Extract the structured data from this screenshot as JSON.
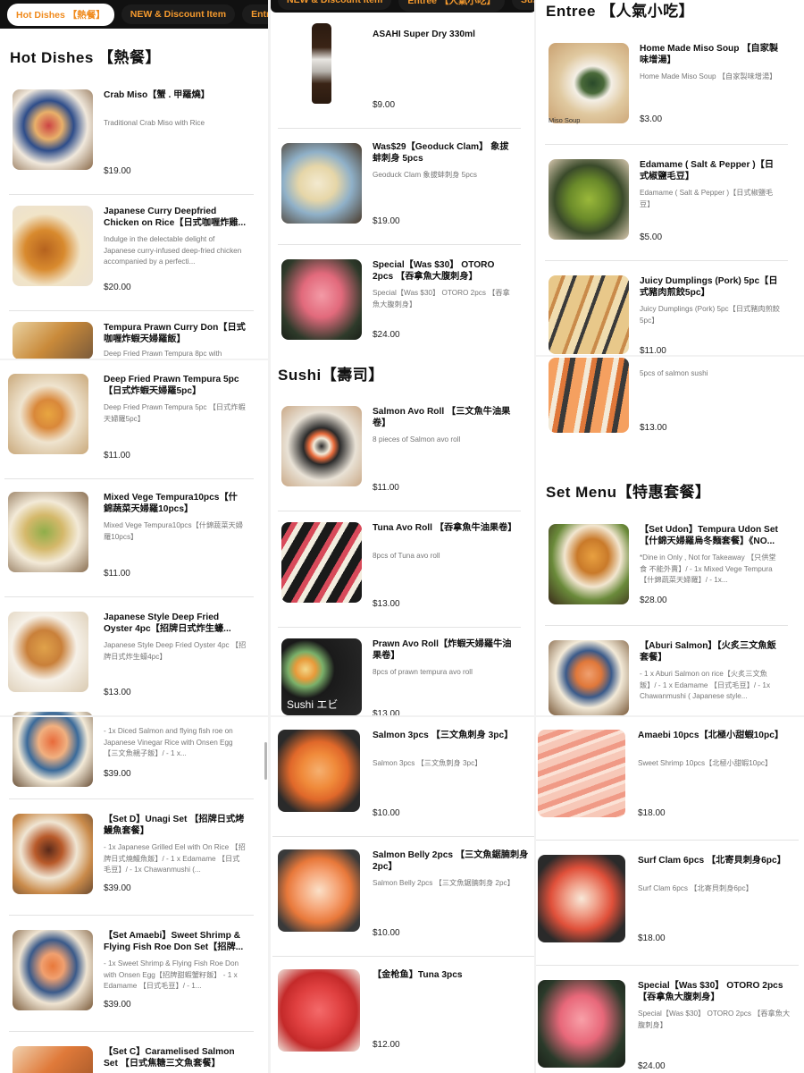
{
  "tabs_left": [
    {
      "label": "Hot Dishes 【熱餐】",
      "active": true
    },
    {
      "label": "NEW & Discount Item"
    },
    {
      "label": "Entree"
    }
  ],
  "tabs_mid": [
    {
      "label": "NEW & Discount Item"
    },
    {
      "label": "Entree 【人氣小吃】"
    },
    {
      "label": "Sushi"
    }
  ],
  "sections": {
    "hot": "Hot Dishes 【熱餐】",
    "sushi": "Sushi【壽司】",
    "entree": "Entree 【人氣小吃】",
    "set": "Set Menu【特惠套餐】"
  },
  "colors": {
    "accent": "#f08a1c",
    "tabbar": "#111111",
    "tab_active_bg": "#ffffff"
  },
  "cards": [
    {
      "name": "Crab Miso【蟹 . 甲羅燒】",
      "desc": "Traditional Crab Miso with Rice",
      "price": "$19.00",
      "img": "img-crab"
    },
    {
      "name": "Japanese Curry Deepfried Chicken on Rice【日式咖喱炸雞...",
      "desc": "Indulge in the delectable delight of Japanese curry-infused deep-fried chicken accompanied by a perfecti...",
      "price": "$20.00",
      "img": "img-curry"
    },
    {
      "name": "Tempura Prawn Curry Don【日式咖喱炸蝦天婦羅飯】",
      "desc": "Deep Fried Prawn Tempura 8pc with",
      "price": "",
      "img": "img-tempcurry"
    },
    {
      "name": "Deep Fried Prawn Tempura 5pc【日式炸蝦天婦羅5pc】",
      "desc": "Deep Fried Prawn Tempura 5pc 【日式炸蝦天婦羅5pc】",
      "price": "$11.00",
      "img": "img-prawn"
    },
    {
      "name": "Mixed Vege Tempura10pcs【什錦蔬菜天婦羅10pcs】",
      "desc": "Mixed Vege Tempura10pcs【什錦蔬菜天婦羅10pcs】",
      "price": "$11.00",
      "img": "img-vege"
    },
    {
      "name": "Japanese Style Deep Fried Oyster 4pc【招牌日式炸生蠔...",
      "desc": "Japanese Style Deep Fried Oyster 4pc 【招牌日式炸生蠔4pc】",
      "price": "$13.00",
      "img": "img-oyster"
    },
    {
      "name": "",
      "desc": "- 1x Diced Salmon and flying fish roe on Japanese Vinegar Rice with Onsen Egg【三文魚親子飯】/ - 1 x...",
      "price": "$39.00",
      "img": "img-salmondon"
    },
    {
      "name": "【Set D】Unagi Set 【招牌日式烤鰻魚套餐】",
      "desc": "- 1x Japanese Grilled Eel with On Rice 【招牌日式燒鰻魚飯】/ - 1 x Edamame 【日式毛豆】/ - 1x Chawanmushi (...",
      "price": "$39.00",
      "img": "img-unagi"
    },
    {
      "name": "【Set Amaebi】Sweet Shrimp & Flying Fish Roe Don Set【招牌...",
      "desc": "- 1x Sweet Shrimp & Flying Fish Roe Don with Onsen Egg【招牌甜蝦蟹籽飯】 - 1 x Edamame 【日式毛豆】/ - 1...",
      "price": "$39.00",
      "img": "img-amaebiset"
    },
    {
      "name": "【Set C】Caramelised Salmon Set 【日式焦糖三文魚套餐】",
      "desc": "",
      "price": "",
      "img": "img-caramel"
    },
    {
      "name": "ASAHI Super Dry 330ml",
      "desc": "",
      "price": "$9.00",
      "img": "img-asahi"
    },
    {
      "name": "Was$29【Geoduck Clam】 象拔蚌刺身 5pcs",
      "desc": "Geoduck Clam 象拔蚌刺身 5pcs",
      "price": "$19.00",
      "img": "img-geoduck"
    },
    {
      "name": "Special【Was $30】 OTORO 2pcs 【吞拿魚大腹刺身】",
      "desc": "Special【Was $30】 OTORO 2pcs 【吞拿魚大腹刺身】",
      "price": "$24.00",
      "img": "img-otoro"
    },
    {
      "name": "Salmon Avo Roll 【三文魚牛油果卷】",
      "desc": "8 pieces of Salmon avo roll",
      "price": "$11.00",
      "img": "img-salmonroll"
    },
    {
      "name": "Tuna Avo Roll 【吞拿魚牛油果卷】",
      "desc": "8pcs of Tuna avo roll",
      "price": "$13.00",
      "img": "img-tunaroll"
    },
    {
      "name": "Prawn Avo Roll【炸蝦天婦羅牛油果卷】",
      "desc": "8pcs of prawn tempura avo roll",
      "price": "$13.00",
      "img": "img-prawnroll",
      "caption": "Sushi エビ"
    },
    {
      "name": "Salmon 3pcs 【三文魚刺身 3pc】",
      "desc": "Salmon 3pcs 【三文魚刺身 3pc】",
      "price": "$10.00",
      "img": "img-salmon"
    },
    {
      "name": "Salmon Belly 2pcs 【三文魚鋸腩刺身 2pc】",
      "desc": "Salmon Belly 2pcs 【三文魚鋸腩刺身 2pc】",
      "price": "$10.00",
      "img": "img-belly"
    },
    {
      "name": "【金枪鱼】Tuna 3pcs",
      "desc": "",
      "price": "$12.00",
      "img": "img-tuna"
    },
    {
      "name": "Home Made Miso Soup 【自家製味增湯】",
      "desc": "Home Made Miso Soup 【自家製味增湯】",
      "price": "$3.00",
      "img": "img-miso",
      "caption": "Miso Soup"
    },
    {
      "name": "Edamame ( Salt & Pepper )【日式椒鹽毛豆】",
      "desc": "Edamame ( Salt & Pepper )【日式椒鹽毛豆】",
      "price": "$5.00",
      "img": "img-edamame"
    },
    {
      "name": "Juicy Dumplings (Pork) 5pc【日式豬肉煎餃5pc】",
      "desc": "Juicy Dumplings (Pork) 5pc【日式豬肉煎餃5pc】",
      "price": "$11.00",
      "img": "img-dumplings"
    },
    {
      "name": "",
      "desc": "5pcs of salmon sushi",
      "price": "$13.00",
      "img": "img-salmonsushi"
    },
    {
      "name": "【Set Udon】Tempura Udon Set【什錦天婦羅烏冬麵套餐】《NO...",
      "desc": "*Dine in Only , Not for Takeaway 【只供堂食 不能外賣】/ - 1x Mixed Vege Tempura【什錦蔬菜天婦羅】/ - 1x...",
      "price": "$28.00",
      "img": "img-udon"
    },
    {
      "name": "【Aburi Salmon】【火炙三文魚飯套餐】",
      "desc": "- 1 x Aburi Salmon on rice【火炙三文魚飯】/ - 1 x Edamame 【日式毛豆】/ - 1x Chawanmushi ( Japanese style...",
      "price": "",
      "img": "img-aburi"
    },
    {
      "name": "Amaebi 10pcs【北極小甜蝦10pc】",
      "desc": "Sweet Shrimp 10pcs【北極小甜蝦10pc】",
      "price": "$18.00",
      "img": "img-amaebi"
    },
    {
      "name": "Surf Clam 6pcs 【北寄貝刺身6pc】",
      "desc": "Surf Clam 6pcs 【北寄貝刺身6pc】",
      "price": "$18.00",
      "img": "img-surfclam"
    },
    {
      "name": "Special【Was $30】 OTORO 2pcs 【吞拿魚大腹刺身】",
      "desc": "Special【Was $30】 OTORO 2pcs 【吞拿魚大腹刺身】",
      "price": "$24.00",
      "img": "img-otoro2"
    }
  ]
}
